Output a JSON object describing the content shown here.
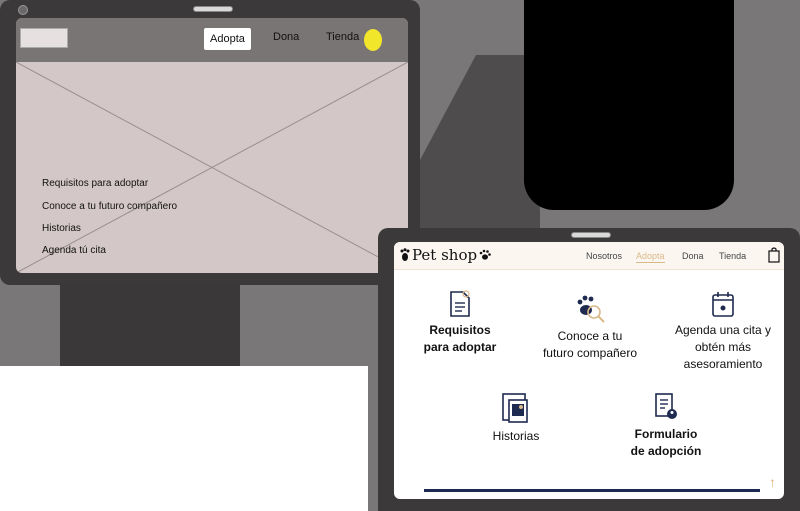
{
  "wireframe": {
    "nav": [
      "Adopta",
      "Dona",
      "Tienda"
    ],
    "active_nav": "Adopta",
    "links": [
      "Requisitos para adoptar",
      "Conoce a tu futuro compañero",
      "Historias",
      "Agenda tú cita"
    ],
    "avatar_color": "#f2e62b"
  },
  "final": {
    "brand": "Pet shop",
    "nav": [
      "Nosotros",
      "Adopta",
      "Dona",
      "Tienda"
    ],
    "active_nav": "Adopta",
    "cards": [
      {
        "line1": "Requisitos",
        "line2": "para adoptar",
        "icon": "document-icon",
        "bold": true
      },
      {
        "line1": "Conoce a tu",
        "line2": "futuro compañero",
        "icon": "paw-search-icon",
        "bold": false
      },
      {
        "line1": "Agenda una cita y",
        "line2": "obtén más",
        "line3": "asesoramiento",
        "icon": "calendar-icon",
        "bold": false
      },
      {
        "line1": "Historias",
        "icon": "photos-icon",
        "bold": false
      },
      {
        "line1": "Formulario",
        "line2": "de adopción",
        "icon": "form-icon",
        "bold": true
      }
    ],
    "accent_color": "#1e2a4f",
    "highlight_color": "#d9b98a"
  }
}
